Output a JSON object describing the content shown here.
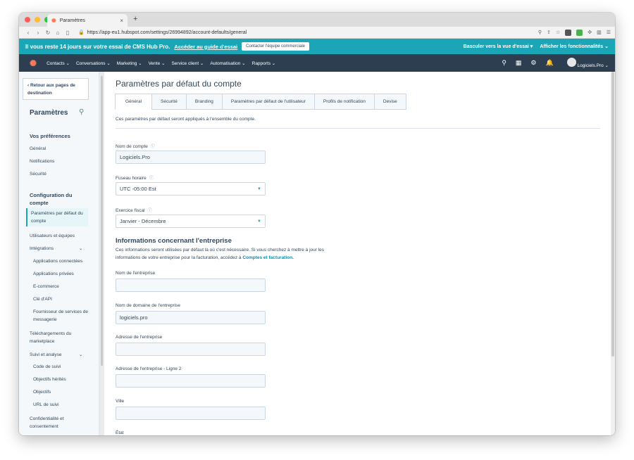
{
  "browser": {
    "tab_title": "Paramètres",
    "tab_close": "×",
    "new_tab": "+",
    "url": "https://app-eu1.hubspot.com/settings/26994892/account-defaults/general"
  },
  "trial": {
    "message": "Il vous reste 14 jours sur votre essai de CMS Hub Pro.",
    "guide_link": "Accéder au guide d'essai",
    "contact_button": "Contacter l'équipe commerciale",
    "switch_view": "Basculer vers la vue d'essai ▾",
    "features": "Afficher les fonctionnalités ⌄"
  },
  "hsnav": {
    "menu": [
      "Contacts ⌄",
      "Conversations ⌄",
      "Marketing ⌄",
      "Vente ⌄",
      "Service client ⌄",
      "Automatisation ⌄",
      "Rapports ⌄"
    ],
    "account": "Logiciels.Pro ⌄"
  },
  "sidebar": {
    "back": "‹  Retour aux pages de destination",
    "title": "Paramètres",
    "prefs_heading": "Vos préférences",
    "prefs": [
      "Général",
      "Notifications",
      "Sécurité"
    ],
    "config_heading": "Configuration du compte",
    "active_item": "Paramètres par défaut du compte",
    "users": "Utilisateurs et équipes",
    "integrations": "Intégrations",
    "integration_items": [
      "Applications connectées",
      "Applications privées",
      "E-commerce",
      "Clé d'API",
      "Fournisseur de services de messagerie"
    ],
    "marketplace": "Téléchargements du marketplace",
    "tracking": "Suivi et analyse",
    "tracking_items": [
      "Code de suivi",
      "Objectifs hérités",
      "Objectifs",
      "URL de suivi"
    ],
    "privacy": "Confidentialité et consentement"
  },
  "main": {
    "title": "Paramètres par défaut du compte",
    "tabs": [
      "Général",
      "Sécurité",
      "Branding",
      "Paramètres par défaut de l'utilisateur",
      "Profils de notification",
      "Devise"
    ],
    "description": "Ces paramètres par défaut seront appliqués à l'ensemble du compte.",
    "account_name_label": "Nom de compte",
    "account_name_value": "Logiciels.Pro",
    "timezone_label": "Fuseau horaire",
    "timezone_value": "UTC -05:00 Est",
    "fiscal_label": "Exercice fiscal",
    "fiscal_value": "Janvier - Décembre",
    "company_section_title": "Informations concernant l'entreprise",
    "company_section_desc": "Ces informations seront utilisées par défaut là où c'est nécessaire. Si vous cherchez à mettre à jour les informations de votre entreprise pour la facturation, accédez à",
    "company_section_link": "Comptes et facturation.",
    "company_name_label": "Nom de l'entreprise",
    "company_domain_label": "Nom de domaine de l'entreprise",
    "company_domain_value": "logiciels.pro",
    "address_label": "Adresse de l'entreprise",
    "address2_label": "Adresse de l'entreprise - Ligne 2",
    "city_label": "Ville",
    "state_label": "État"
  },
  "colors": {
    "accent": "#1aa6b7",
    "nav": "#2d3e50",
    "text": "#33475b",
    "hubspot_orange": "#ff7a59"
  }
}
